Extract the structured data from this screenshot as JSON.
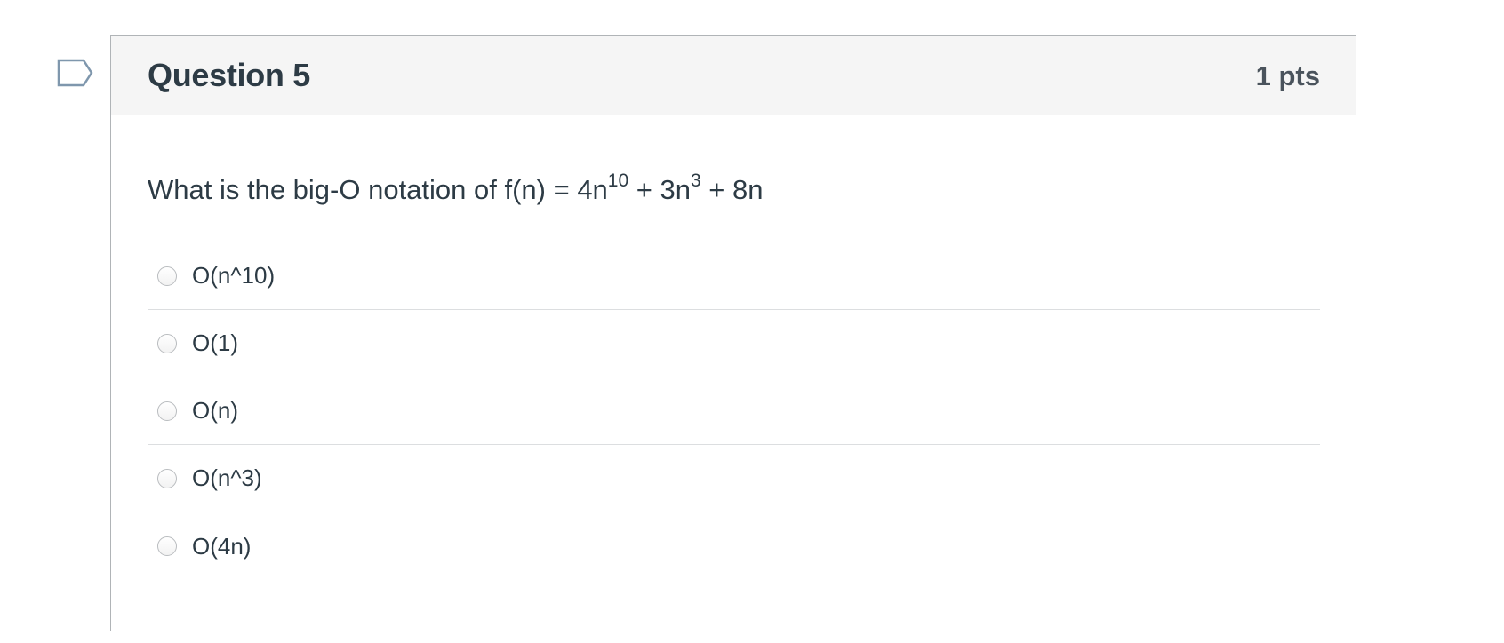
{
  "question": {
    "title": "Question 5",
    "points": "1 pts",
    "text": {
      "prefix": "What is the big-O notation of f(n) = 4n",
      "exp1": "10",
      "middle": " + 3n",
      "exp2": "3",
      "suffix": " + 8n"
    }
  },
  "answers": [
    {
      "label": "O(n^10)",
      "selected": false
    },
    {
      "label": "O(1)",
      "selected": false
    },
    {
      "label": "O(n)",
      "selected": false
    },
    {
      "label": "O(n^3)",
      "selected": false
    },
    {
      "label": "O(4n)",
      "selected": false
    }
  ],
  "icons": {
    "flag": "flag-question-icon"
  },
  "colors": {
    "text": "#2d3b45",
    "points": "#4a535c",
    "header_bg": "#f5f5f5",
    "border": "#b0b4b7",
    "divider": "#dcdee0",
    "flag": "#7f97ad"
  }
}
